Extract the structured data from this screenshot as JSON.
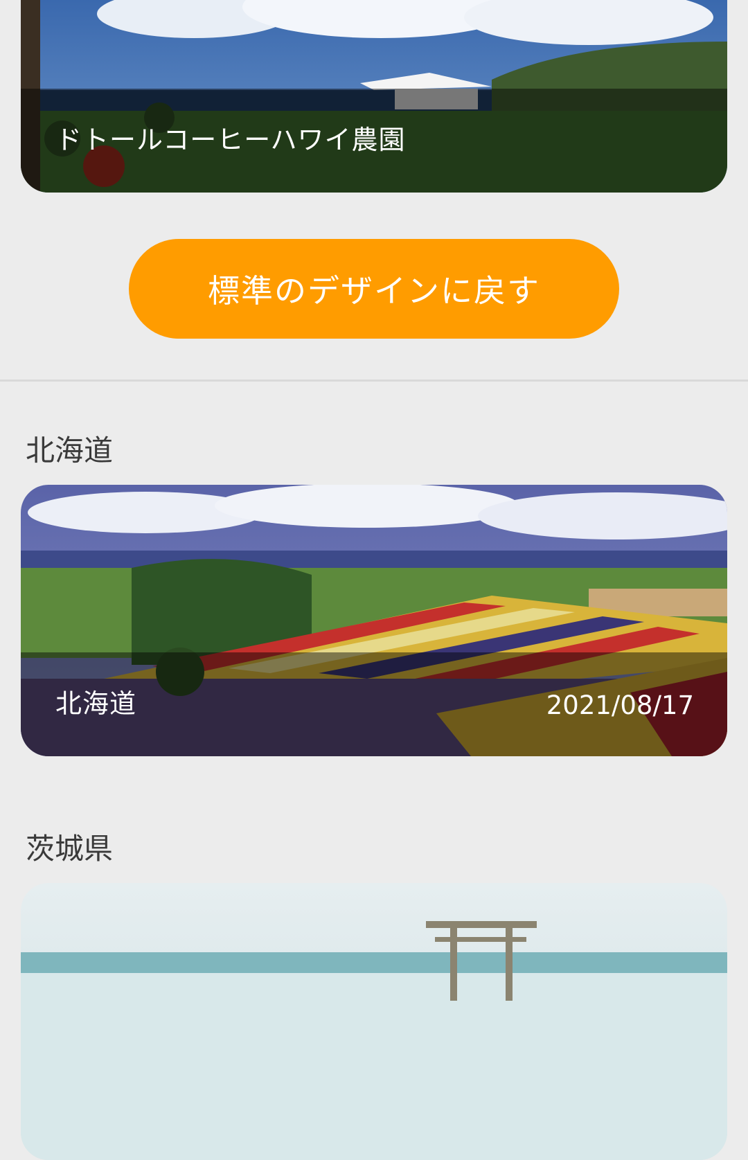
{
  "cards": [
    {
      "title": "ドトールコーヒーハワイ農園",
      "date": ""
    },
    {
      "title": "北海道",
      "date": "2021/08/17"
    }
  ],
  "reset_button": {
    "label": "標準のデザインに戻す"
  },
  "sections": [
    {
      "title": "北海道"
    },
    {
      "title": "茨城県"
    }
  ],
  "colors": {
    "accent": "#ff9c00",
    "background": "#ececec",
    "text": "#3a3a3a"
  }
}
